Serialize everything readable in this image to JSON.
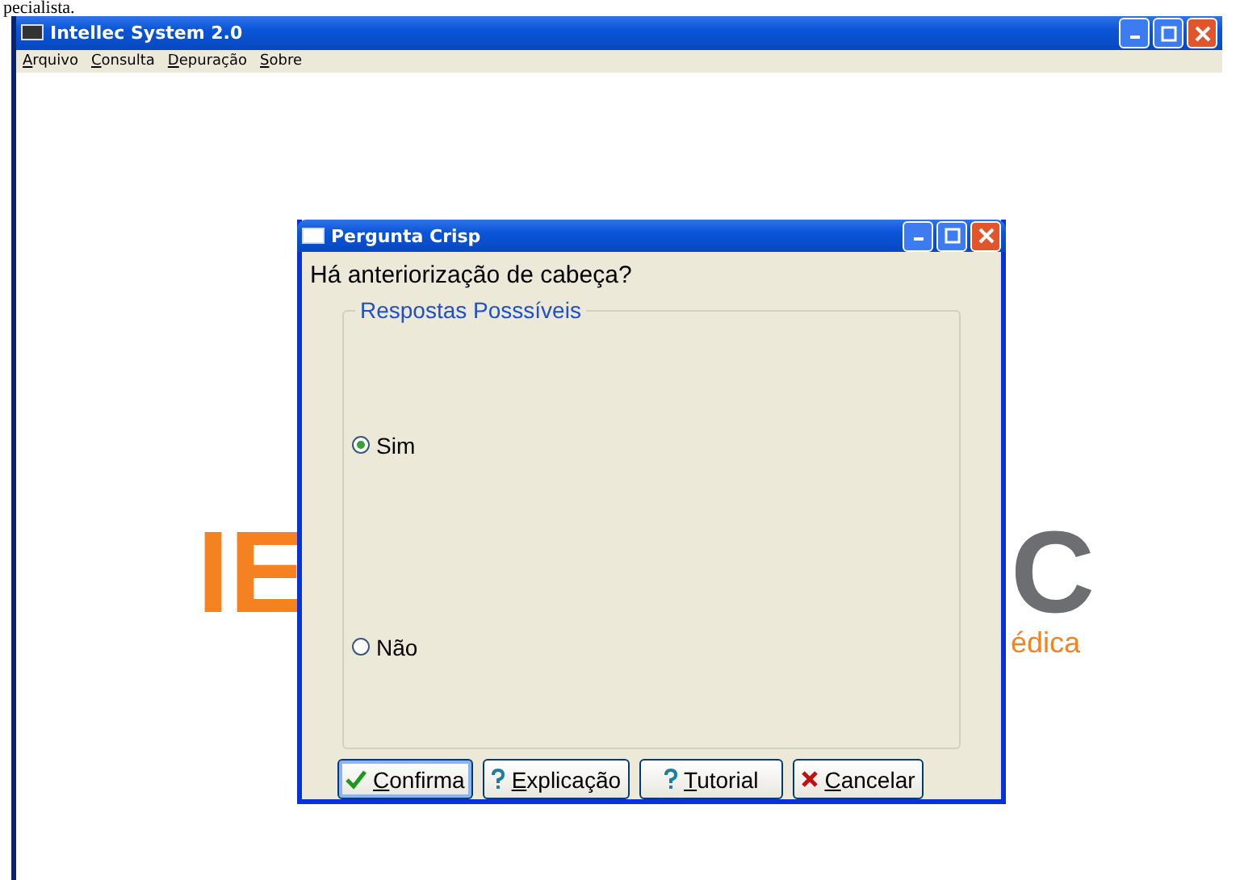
{
  "background_text": "pecialista.",
  "window": {
    "title": "Intellec System 2.0"
  },
  "menu": [
    "Arquivo",
    "Consulta",
    "Depuração",
    "Sobre"
  ],
  "logo": {
    "left": "IE",
    "right": "C",
    "subtitle": "édica"
  },
  "dialog": {
    "title": "Pergunta Crisp",
    "question": "Há anteriorização de cabeça?",
    "group_title": "Respostas Posssíveis",
    "options": [
      {
        "label": "Sim",
        "selected": true
      },
      {
        "label": "Não",
        "selected": false
      }
    ],
    "buttons": [
      {
        "kind": "confirm",
        "label": "Confirma",
        "focused": true
      },
      {
        "kind": "help",
        "label": "Explicação",
        "focused": false
      },
      {
        "kind": "help",
        "label": "Tutorial",
        "focused": false
      },
      {
        "kind": "cancel",
        "label": "Cancelar",
        "focused": false
      }
    ]
  }
}
